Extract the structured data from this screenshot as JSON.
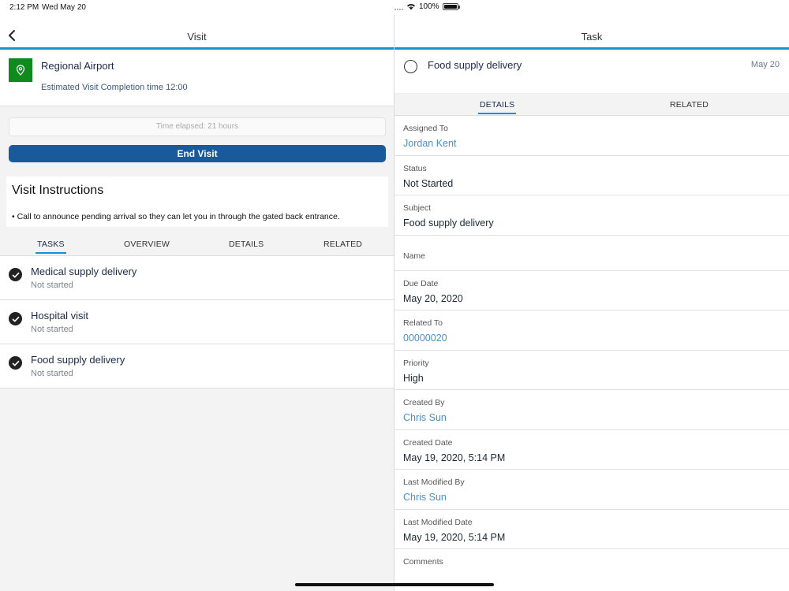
{
  "status_bar": {
    "time": "2:12 PM",
    "date": "Wed May 20",
    "battery": "100%"
  },
  "left": {
    "nav_title": "Visit",
    "visit": {
      "name": "Regional Airport",
      "estimate": "Estimated Visit Completion time 12:00"
    },
    "elapsed": "Time elapsed: 21 hours",
    "end_button": "End Visit",
    "instructions": {
      "heading": "Visit Instructions",
      "body": "• Call to announce pending arrival so they can let you in through the gated back entrance."
    },
    "tabs": [
      "TASKS",
      "OVERVIEW",
      "DETAILS",
      "RELATED"
    ],
    "tasks": [
      {
        "title": "Medical supply delivery",
        "status": "Not started"
      },
      {
        "title": "Hospital visit",
        "status": "Not started"
      },
      {
        "title": "Food supply delivery",
        "status": "Not started"
      }
    ]
  },
  "right": {
    "nav_title": "Task",
    "task": {
      "title": "Food supply delivery",
      "date": "May 20"
    },
    "tabs": [
      "DETAILS",
      "RELATED"
    ],
    "fields": [
      {
        "label": "Assigned To",
        "value": "Jordan Kent",
        "link": true
      },
      {
        "label": "Status",
        "value": "Not Started",
        "link": false
      },
      {
        "label": "Subject",
        "value": "Food supply delivery",
        "link": false
      },
      {
        "label": "Name",
        "value": "",
        "link": false
      },
      {
        "label": "Due Date",
        "value": "May 20, 2020",
        "link": false
      },
      {
        "label": "Related To",
        "value": "00000020",
        "link": true
      },
      {
        "label": "Priority",
        "value": "High",
        "link": false
      },
      {
        "label": "Created By",
        "value": "Chris Sun",
        "link": true
      },
      {
        "label": "Created Date",
        "value": "May 19, 2020, 5:14 PM",
        "link": false
      },
      {
        "label": "Last Modified By",
        "value": "Chris Sun",
        "link": true
      },
      {
        "label": "Last Modified Date",
        "value": "May 19, 2020, 5:14 PM",
        "link": false
      },
      {
        "label": "Comments",
        "value": "",
        "link": false
      }
    ]
  },
  "colors": {
    "accent": "#1a8fd4",
    "primary_button": "#1b5a9a",
    "location_icon": "#0f8a1d",
    "link": "#4a90c8"
  }
}
